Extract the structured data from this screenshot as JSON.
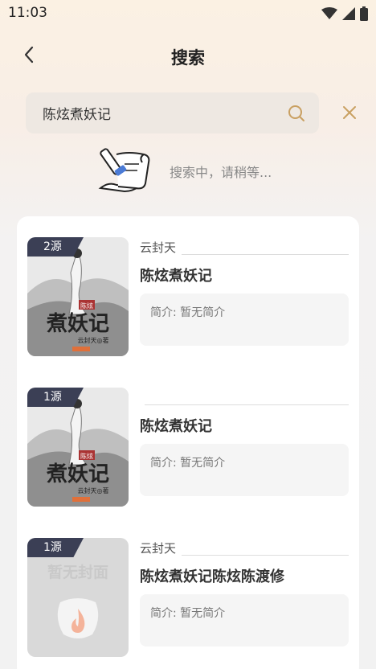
{
  "status": {
    "time": "11:03"
  },
  "header": {
    "title": "搜索"
  },
  "search": {
    "query": "陈炫煮妖记",
    "placeholder": ""
  },
  "loading": {
    "text": "搜索中，请稍等..."
  },
  "results": [
    {
      "sources": "2源",
      "author": "云封天",
      "title": "陈炫煮妖记",
      "intro": "简介: 暂无简介",
      "cover": "art"
    },
    {
      "sources": "1源",
      "author": "",
      "title": "陈炫煮妖记",
      "intro": "简介: 暂无简介",
      "cover": "art"
    },
    {
      "sources": "1源",
      "author": "云封天",
      "title": "陈炫煮妖记陈炫陈渡修",
      "intro": "简介: 暂无简介",
      "cover": "none",
      "no_cover_text": "暂无封面"
    }
  ],
  "cover_art_text": {
    "main": "煮妖记",
    "tag": "陈炫",
    "author": "云封天◎著"
  },
  "icons": {
    "back": "chevron-left-icon",
    "search": "search-icon",
    "clear": "close-icon",
    "wifi": "wifi-icon",
    "signal": "signal-icon",
    "battery": "battery-icon"
  },
  "colors": {
    "accent": "#c9a062",
    "badge": "#3b3f55"
  }
}
